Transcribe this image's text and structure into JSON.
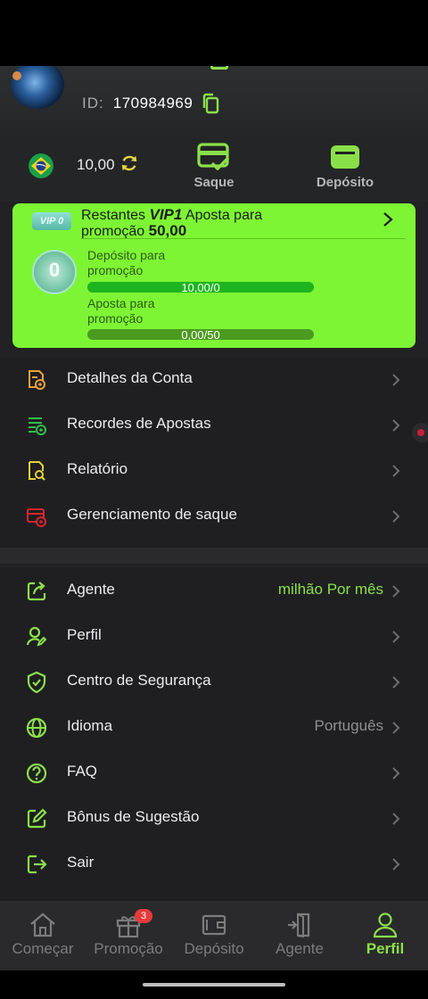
{
  "profile": {
    "id_label": "ID:",
    "id_value": "170984969"
  },
  "wallet": {
    "balance": "10,00",
    "withdraw_label": "Saque",
    "deposit_label": "Depósito"
  },
  "vip": {
    "badge": "VIP 0",
    "line1_prefix": "Restantes",
    "line1_level": "VIP1",
    "line1_suffix": "Aposta para",
    "line2_prefix": "promoção",
    "line2_amount": "50,00",
    "medal_level": "0",
    "deposit_label_1": "Depósito para",
    "deposit_label_2": "promoção",
    "deposit_progress_text": "10,00/0",
    "deposit_progress": 1.0,
    "bet_label_1": "Aposta para",
    "bet_label_2": "promoção",
    "bet_progress_text": "0,00/50",
    "bet_progress": 0.0
  },
  "menu_primary": [
    {
      "label": "Detalhes da Conta",
      "icon": "account-details-icon",
      "color": "#e9a33a"
    },
    {
      "label": "Recordes de Apostas",
      "icon": "bet-records-icon",
      "color": "#2fbf4a"
    },
    {
      "label": "Relatório",
      "icon": "report-icon",
      "color": "#e3d23a"
    },
    {
      "label": "Gerenciamento de saque",
      "icon": "withdraw-management-icon",
      "color": "#d8262e"
    }
  ],
  "menu_secondary": [
    {
      "label": "Agente",
      "value": "milhão Por mês",
      "icon": "share-icon"
    },
    {
      "label": "Perfil",
      "value": "",
      "icon": "user-edit-icon"
    },
    {
      "label": "Centro de Segurança",
      "value": "",
      "icon": "shield-icon"
    },
    {
      "label": "Idioma",
      "value": "Português",
      "icon": "globe-icon"
    },
    {
      "label": "FAQ",
      "value": "",
      "icon": "question-icon"
    },
    {
      "label": "Bônus de Sugestão",
      "value": "",
      "icon": "edit-icon"
    },
    {
      "label": "Sair",
      "value": "",
      "icon": "logout-icon"
    }
  ],
  "bottom_nav": [
    {
      "label": "Começar",
      "icon": "home-icon"
    },
    {
      "label": "Promoção",
      "icon": "gift-icon",
      "badge": "3"
    },
    {
      "label": "Depósito",
      "icon": "wallet-icon"
    },
    {
      "label": "Agente",
      "icon": "door-icon"
    },
    {
      "label": "Perfil",
      "icon": "user-icon",
      "active": true
    }
  ],
  "colors": {
    "accent": "#8be04a",
    "vip_card": "#7df534",
    "background": "#222224"
  }
}
